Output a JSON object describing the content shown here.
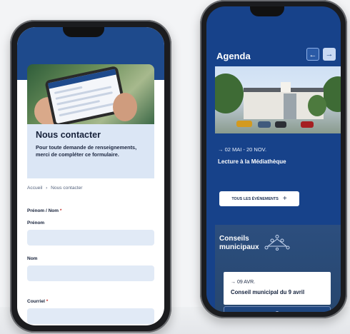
{
  "left_phone": {
    "hero": {
      "title": "Nous contacter",
      "text": "Pour toute demande de renseignements, merci de compléter ce formulaire."
    },
    "breadcrumb": {
      "home": "Accueil",
      "separator": "›",
      "current": "Nous contacter"
    },
    "form": {
      "group_label": "Prénom / Nom",
      "required_mark": "*",
      "fields": [
        {
          "label": "Prénom",
          "value": ""
        },
        {
          "label": "Nom",
          "value": ""
        },
        {
          "label": "Courriel",
          "value": ""
        }
      ]
    }
  },
  "right_phone": {
    "title": "Agenda",
    "nav": {
      "prev": "←",
      "next": "→"
    },
    "event": {
      "date": "→ 02 MAI - 20 NOV.",
      "name": "Lecture à la Médiathèque"
    },
    "all_events_button": "TOUS LES ÉVÉNEMENTS",
    "all_events_plus": "+",
    "councils": {
      "title_line1": "Conseils",
      "title_line2": "municipaux",
      "card": {
        "date": "→ 09 AVR.",
        "name": "Conseil municipal du 9 avril"
      }
    }
  },
  "colors": {
    "primary_blue": "#1e4a8c",
    "light_blue": "#dbe6f5",
    "input_fill": "#e1eaf6"
  }
}
